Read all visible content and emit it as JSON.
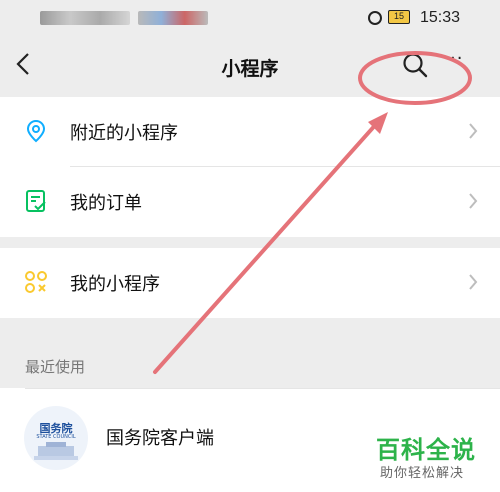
{
  "status_bar": {
    "time": "15:33",
    "battery": "15"
  },
  "header": {
    "title": "小程序",
    "back_icon": "chevron-left-icon",
    "search_icon": "search-icon",
    "more": "··"
  },
  "menu_group_1": [
    {
      "label": "附近的小程序",
      "icon": "location-pin-icon"
    },
    {
      "label": "我的订单",
      "icon": "order-list-icon"
    }
  ],
  "menu_group_2": [
    {
      "label": "我的小程序",
      "icon": "mini-program-icon"
    }
  ],
  "recent": {
    "section_label": "最近使用",
    "items": [
      {
        "name": "国务院客户端",
        "avatar_text": "国务院",
        "avatar_sub": "STATE COUNCIL"
      }
    ]
  },
  "watermark": {
    "main": "百科全说",
    "sub": "助你轻松解决"
  },
  "colors": {
    "accent_green": "#2db34a",
    "annotation": "#e57379",
    "location_blue": "#10aeff",
    "order_green": "#07c160",
    "mini_yellow": "#fac92f"
  }
}
